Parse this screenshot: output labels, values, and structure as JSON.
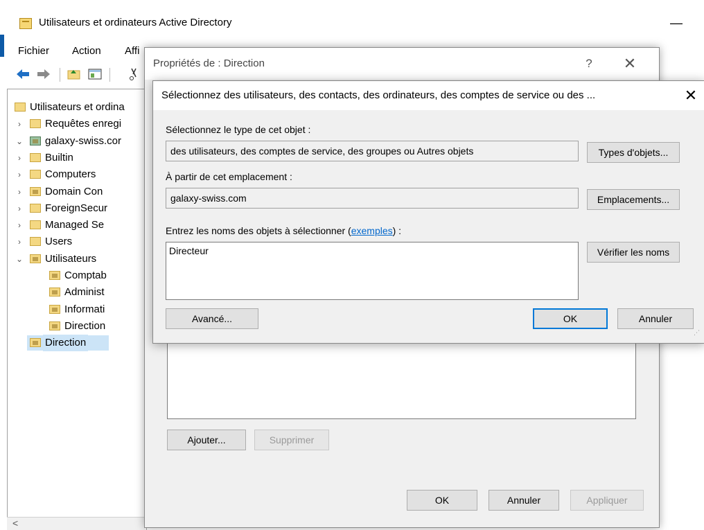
{
  "mmc": {
    "title": "Utilisateurs et ordinateurs Active Directory",
    "minimize": "—",
    "menu": [
      "Fichier",
      "Action",
      "Affi"
    ],
    "tree": [
      {
        "label": "Utilisateurs et ordina",
        "indent": 0,
        "arrow": "",
        "icon": "root"
      },
      {
        "label": "Requêtes enregi",
        "indent": 1,
        "arrow": "›",
        "icon": "folder"
      },
      {
        "label": "galaxy-swiss.cor",
        "indent": 1,
        "arrow": "⌄",
        "icon": "domain"
      },
      {
        "label": "Builtin",
        "indent": 2,
        "arrow": "›",
        "icon": "folder"
      },
      {
        "label": "Computers",
        "indent": 2,
        "arrow": "›",
        "icon": "folder"
      },
      {
        "label": "Domain Con",
        "indent": 2,
        "arrow": "›",
        "icon": "ou"
      },
      {
        "label": "ForeignSecur",
        "indent": 2,
        "arrow": "›",
        "icon": "folder"
      },
      {
        "label": "Managed Se",
        "indent": 2,
        "arrow": "›",
        "icon": "folder"
      },
      {
        "label": "Users",
        "indent": 2,
        "arrow": "›",
        "icon": "folder"
      },
      {
        "label": "Utilisateurs",
        "indent": 2,
        "arrow": "⌄",
        "icon": "ou"
      },
      {
        "label": "Comptab",
        "indent": 3,
        "arrow": "",
        "icon": "ou"
      },
      {
        "label": "Administ",
        "indent": 3,
        "arrow": "",
        "icon": "ou"
      },
      {
        "label": "Informati",
        "indent": 3,
        "arrow": "",
        "icon": "ou"
      },
      {
        "label": "Direction",
        "indent": 3,
        "arrow": "",
        "icon": "ou"
      },
      {
        "label": "Direction",
        "indent": 2,
        "arrow": "",
        "icon": "ou",
        "selected": true
      }
    ]
  },
  "properties": {
    "title": "Propriétés de : Direction",
    "help": "?",
    "close": "✕",
    "add_button": "Ajouter...",
    "remove_button": "Supprimer",
    "ok_button": "OK",
    "cancel_button": "Annuler",
    "apply_button": "Appliquer"
  },
  "select_dialog": {
    "title": "Sélectionnez des utilisateurs, des contacts, des ordinateurs, des comptes de service ou des ...",
    "close": "✕",
    "object_type_label": "Sélectionnez le type de cet objet :",
    "object_type_value": "des utilisateurs, des comptes de service, des groupes ou Autres objets",
    "object_types_button": "Types d'objets...",
    "location_label": "À partir de cet emplacement :",
    "location_value": "galaxy-swiss.com",
    "locations_button": "Emplacements...",
    "names_label_prefix": "Entrez les noms des objets à sélectionner (",
    "names_label_link": "exemples",
    "names_label_suffix": ") :",
    "names_value": "Directeur",
    "check_names_button": "Vérifier les noms",
    "advanced_button": "Avancé...",
    "ok_button": "OK",
    "cancel_button": "Annuler"
  },
  "colors": {
    "accent": "#0078d7",
    "link": "#0066cc",
    "selection": "#cce4f7"
  }
}
